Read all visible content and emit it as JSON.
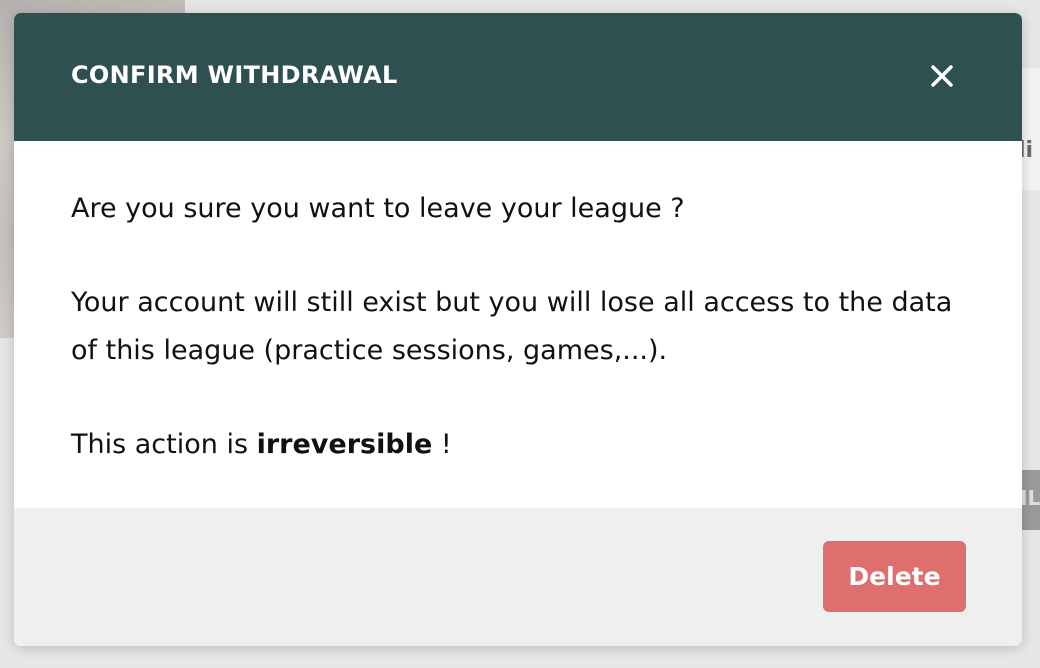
{
  "modal": {
    "title": "CONFIRM WITHDRAWAL",
    "close_icon": "close-icon",
    "body": {
      "line1": "Are you sure you want to leave your league ?",
      "line2": "Your account will still exist but you will lose all access to the data of this league (practice sessions, games,...).",
      "line3_prefix": "This action is ",
      "line3_bold": "irreversible",
      "line3_suffix": " !"
    },
    "footer": {
      "delete_label": "Delete"
    }
  },
  "background": {
    "partial_text_right": "li",
    "partial_button_text": "IL"
  },
  "colors": {
    "header_bg": "#2f5050",
    "delete_bg": "#df6e6e",
    "footer_bg": "#efefef"
  }
}
